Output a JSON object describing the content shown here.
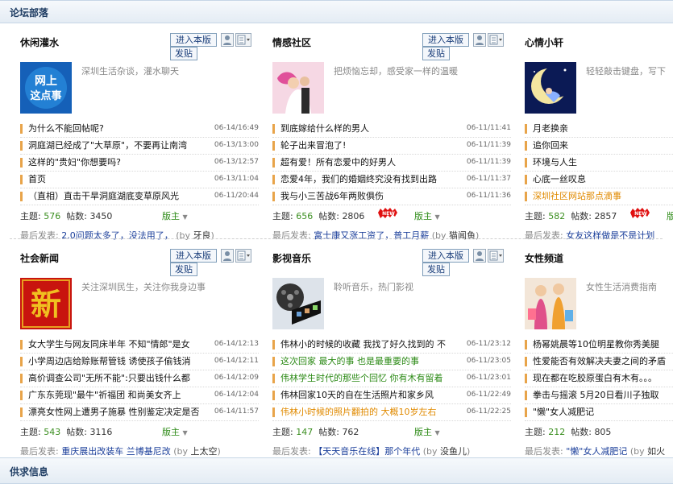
{
  "section_title": "论坛部落",
  "bottom_section_title": "供求信息",
  "buttons": {
    "enter": "进入本版",
    "post": "发贴"
  },
  "labels": {
    "topics": "主题:",
    "posts": "帖数:",
    "mod": "版主",
    "last": "最后发表:",
    "by_open": "(by",
    "by_close": ")"
  },
  "forums": [
    {
      "title": "休闲灌水",
      "desc": "深圳生活杂谈，灌水聊天",
      "icon": "wangshang-zhedianshi-logo",
      "threads": [
        {
          "t": "为什么不能回帖呢?",
          "d": "06-14/16:49",
          "style": ""
        },
        {
          "t": "洞庭湖已经成了\"大草原\"，不要再让南湾",
          "d": "06-13/13:00",
          "style": ""
        },
        {
          "t": "这样的\"贵妇\"你想要吗?",
          "d": "06-13/12:57",
          "style": ""
        },
        {
          "t": "首页",
          "d": "06-13/11:04",
          "style": ""
        },
        {
          "t": "（直相）直击干旱洞庭湖底变草原风光",
          "d": "06-11/20:44",
          "style": ""
        }
      ],
      "topics": "576",
      "posts": "3450",
      "new": false,
      "last_topic": "2.0问题太多了，没法用了，",
      "last_by": "牙良"
    },
    {
      "title": "情感社区",
      "desc": "把烦恼忘却，感受家一样的温暖",
      "icon": "wedding-couple-photo",
      "threads": [
        {
          "t": "到底嫁给什么样的男人",
          "d": "06-11/11:41",
          "style": ""
        },
        {
          "t": "轮子出来冒泡了!",
          "d": "06-11/11:39",
          "style": ""
        },
        {
          "t": "超有爱！所有恋爱中的好男人",
          "d": "06-11/11:39",
          "style": ""
        },
        {
          "t": "恋爱4年，我们的婚姻终究没有找到出路",
          "d": "06-11/11:37",
          "style": ""
        },
        {
          "t": "我与小三苦战6年两败俱伤",
          "d": "06-11/11:36",
          "style": ""
        }
      ],
      "topics": "656",
      "posts": "2806",
      "new": true,
      "last_topic": "富士康又涨工资了，普工月薪",
      "last_by": "猫闻鱼"
    },
    {
      "title": "心情小轩",
      "desc": "轻轻敲击键盘，写下",
      "icon": "moon-girl-photo",
      "threads": [
        {
          "t": "月老换亲",
          "d": "",
          "style": ""
        },
        {
          "t": "追你回来",
          "d": "",
          "style": ""
        },
        {
          "t": "环境与人生",
          "d": "",
          "style": ""
        },
        {
          "t": "心底一丝叹息",
          "d": "",
          "style": ""
        },
        {
          "t": "深圳社区网站那点滴事",
          "d": "",
          "style": "orange"
        }
      ],
      "topics": "582",
      "posts": "2857",
      "new": true,
      "last_topic": "女友这样做是不是计划",
      "last_by": ""
    },
    {
      "title": "社会新闻",
      "desc": "关注深圳民生，关注你我身边事",
      "icon": "xin-red-logo",
      "threads": [
        {
          "t": "女大学生与网友同床半年 不知\"情郎\"是女",
          "d": "06-14/12:13",
          "style": ""
        },
        {
          "t": "小学周边店给赊账帮管钱 诱使孩子偷钱消",
          "d": "06-14/12:11",
          "style": ""
        },
        {
          "t": "高价调查公司\"无所不能\":只要出钱什么都",
          "d": "06-14/12:09",
          "style": ""
        },
        {
          "t": "广东东莞现\"最牛\"祈福团 和尚美女齐上",
          "d": "06-14/12:04",
          "style": ""
        },
        {
          "t": "漂亮女性网上遭男子施暴 性别鉴定决定是否",
          "d": "06-14/11:57",
          "style": ""
        }
      ],
      "topics": "543",
      "posts": "3116",
      "new": false,
      "last_topic": "重庆展出改装车 兰博基尼改",
      "last_by": "上太空"
    },
    {
      "title": "影视音乐",
      "desc": "聆听音乐，热门影视",
      "icon": "film-reel-photo",
      "threads": [
        {
          "t": "伟林小的时候的收藏 我找了好久找到的 不",
          "d": "06-11/23:12",
          "style": ""
        },
        {
          "t": "这次回家 最大的事 也是最重要的事",
          "d": "06-11/23:05",
          "style": "green"
        },
        {
          "t": "伟林学生时代的那些个回忆 你有木有留着",
          "d": "06-11/23:01",
          "style": "green"
        },
        {
          "t": "伟林回家10天的自在生活照片和家乡风",
          "d": "06-11/22:49",
          "style": ""
        },
        {
          "t": "伟林小时候的照片翻拍的 大概10岁左右",
          "d": "06-11/22:25",
          "style": "orange"
        }
      ],
      "topics": "147",
      "posts": "762",
      "new": false,
      "last_topic": "【天天音乐在线】那个年代",
      "last_by": "没鱼儿"
    },
    {
      "title": "女性频道",
      "desc": "女性生活消费指南",
      "icon": "shopping-women-photo",
      "threads": [
        {
          "t": "杨幂姚晨等10位明星教你秀美腿",
          "d": "",
          "style": ""
        },
        {
          "t": "性爱能否有效解决夫妻之间的矛盾",
          "d": "",
          "style": ""
        },
        {
          "t": "现在都在吃胶原蛋白有木有。。。",
          "d": "",
          "style": ""
        },
        {
          "t": "拳击与摇滚 5月20日看川子独取",
          "d": "",
          "style": ""
        },
        {
          "t": "\"懒\"女人减肥记",
          "d": "",
          "style": ""
        }
      ],
      "topics": "212",
      "posts": "805",
      "new": false,
      "last_topic": "\"懒\"女人减肥记",
      "last_by": "如火"
    }
  ],
  "colors": {
    "link": "#1a3e9a",
    "green": "#2c8a16",
    "orange": "#e08a00",
    "accent_bar": "#e8a44a"
  }
}
